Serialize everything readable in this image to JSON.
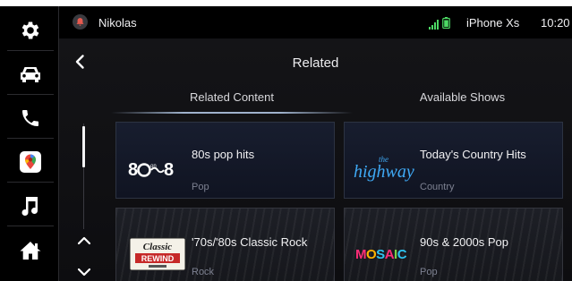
{
  "status_bar": {
    "user_name": "Nikolas",
    "device_name": "iPhone Xs",
    "time": "10:20",
    "icons": [
      "notification-bell-icon",
      "signal-icon",
      "battery-icon"
    ]
  },
  "dock": {
    "items": [
      {
        "name": "settings",
        "icon": "gear-icon"
      },
      {
        "name": "vehicle",
        "icon": "car-icon"
      },
      {
        "name": "phone",
        "icon": "phone-icon"
      },
      {
        "name": "maps",
        "icon": "map-pin-icon"
      },
      {
        "name": "music",
        "icon": "music-note-icon"
      },
      {
        "name": "home",
        "icon": "home-icon"
      }
    ]
  },
  "header": {
    "title": "Related",
    "back_icon": "chevron-left-icon"
  },
  "tabs": [
    {
      "label": "Related Content",
      "selected": true
    },
    {
      "label": "Available Shows",
      "selected": false
    }
  ],
  "cards": [
    {
      "name": "80s pop hits",
      "genre": "Pop",
      "logo": "80s-on-8-logo",
      "logo_text": "80s on 8"
    },
    {
      "name": "Today's Country Hits",
      "genre": "Country",
      "logo": "the-highway-logo",
      "logo_text": "the highway"
    },
    {
      "name": "'70s/'80s Classic Rock",
      "genre": "Rock",
      "logo": "classic-rewind-logo",
      "logo_text": "Classic Rewind"
    },
    {
      "name": "90s & 2000s Pop",
      "genre": "Pop",
      "logo": "mosaic-logo",
      "logo_text": "MOSAIC"
    }
  ],
  "scroll": {
    "up_icon": "chevron-up-icon",
    "down_icon": "chevron-down-icon"
  },
  "colors": {
    "background": "#0b0b0e",
    "dock": "#000000",
    "accent_underline": "#9fb2cc",
    "genre_text": "#7d8191"
  }
}
